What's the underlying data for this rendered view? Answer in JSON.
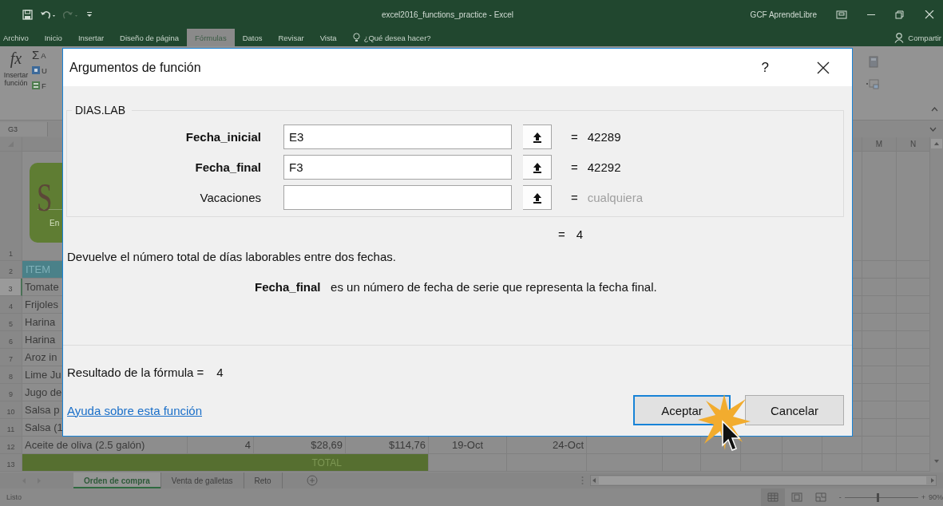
{
  "title_bar": {
    "title": "excel2016_functions_practice  -  Excel",
    "user": "GCF AprendeLibre"
  },
  "ribbon_tabs": [
    {
      "label": "Archivo",
      "selected": false
    },
    {
      "label": "Inicio",
      "selected": false
    },
    {
      "label": "Insertar",
      "selected": false
    },
    {
      "label": "Diseño de página",
      "selected": false
    },
    {
      "label": "Fórmulas",
      "selected": true
    },
    {
      "label": "Datos",
      "selected": false
    },
    {
      "label": "Revisar",
      "selected": false
    },
    {
      "label": "Vista",
      "selected": false
    }
  ],
  "tell_me": {
    "placeholder": "¿Qué desea hacer?"
  },
  "share": "Compartir",
  "ribbon": {
    "insert_function": {
      "symbol": "fx",
      "label": "Insertar función"
    },
    "commands": [
      {
        "kind": "sum",
        "symbol": "Σ",
        "label": "A"
      },
      {
        "kind": "recent",
        "label": "U"
      },
      {
        "kind": "financial",
        "label": "F"
      }
    ]
  },
  "name_box": "G3",
  "sheet": {
    "column_headers": [
      "M",
      "N"
    ],
    "rows": [
      {
        "number": "1",
        "selected": false,
        "kind": "logo",
        "logo": {
          "title": "S",
          "subtitle": "En"
        }
      },
      {
        "number": "2",
        "selected": false,
        "kind": "header",
        "cells": [
          "ITEM"
        ]
      },
      {
        "number": "3",
        "selected": true,
        "kind": "data",
        "cells": [
          "Tomate"
        ]
      },
      {
        "number": "4",
        "selected": false,
        "kind": "data",
        "cells": [
          "Frijoles"
        ]
      },
      {
        "number": "5",
        "selected": false,
        "kind": "data",
        "cells": [
          "Harina"
        ]
      },
      {
        "number": "6",
        "selected": false,
        "kind": "data",
        "cells": [
          "Harina"
        ]
      },
      {
        "number": "7",
        "selected": false,
        "kind": "data",
        "cells": [
          "Aroz in"
        ]
      },
      {
        "number": "8",
        "selected": false,
        "kind": "data",
        "cells": [
          "Lime Ju"
        ]
      },
      {
        "number": "9",
        "selected": false,
        "kind": "data",
        "cells": [
          "Jugo de"
        ]
      },
      {
        "number": "10",
        "selected": false,
        "kind": "data",
        "cells": [
          "Salsa p"
        ]
      },
      {
        "number": "11",
        "selected": false,
        "kind": "data",
        "cells": [
          "Salsa (1"
        ]
      },
      {
        "number": "12",
        "selected": false,
        "kind": "data",
        "cells": [
          "Aceite de oliva (2.5 galón)",
          "4",
          "$28,69",
          "$114,76",
          "19-Oct",
          "24-Oct"
        ]
      },
      {
        "number": "13",
        "selected": false,
        "kind": "total",
        "total": "TOTAL"
      }
    ]
  },
  "sheet_tabs": [
    {
      "label": "Orden de compra",
      "selected": true
    },
    {
      "label": "Venta de galletas",
      "selected": false
    },
    {
      "label": "Reto",
      "selected": false
    }
  ],
  "status_bar": {
    "status": "Listo",
    "zoom": {
      "minus": "-",
      "level": 0.45,
      "plus": "+",
      "reading": "90%"
    }
  },
  "dialog": {
    "title": "Argumentos de función",
    "help": "?",
    "function_name": "DIAS.LAB",
    "arguments": [
      {
        "label": "Fecha_inicial",
        "required": true,
        "value": "E3",
        "equals": "=",
        "result": "42289",
        "result_muted": false
      },
      {
        "label": "Fecha_final",
        "required": true,
        "value": "F3",
        "equals": "=",
        "result": "42292",
        "result_muted": false
      },
      {
        "label": "Vacaciones",
        "required": false,
        "equals": "=",
        "result": "cualquiera",
        "result_muted": true
      }
    ],
    "total": {
      "equals": "=",
      "value": "4"
    },
    "description": "Devuelve el número total de días laborables entre dos fechas.",
    "argument_help": "**Fecha_final**   es un número de fecha de serie que representa la fecha final.",
    "formula_result": {
      "label": "Resultado de la fórmula =",
      "value": "4"
    },
    "help_link": "Ayuda sobre esta función",
    "buttons": [
      {
        "label": "Aceptar",
        "default": true
      },
      {
        "label": "Cancelar",
        "default": false
      }
    ]
  }
}
